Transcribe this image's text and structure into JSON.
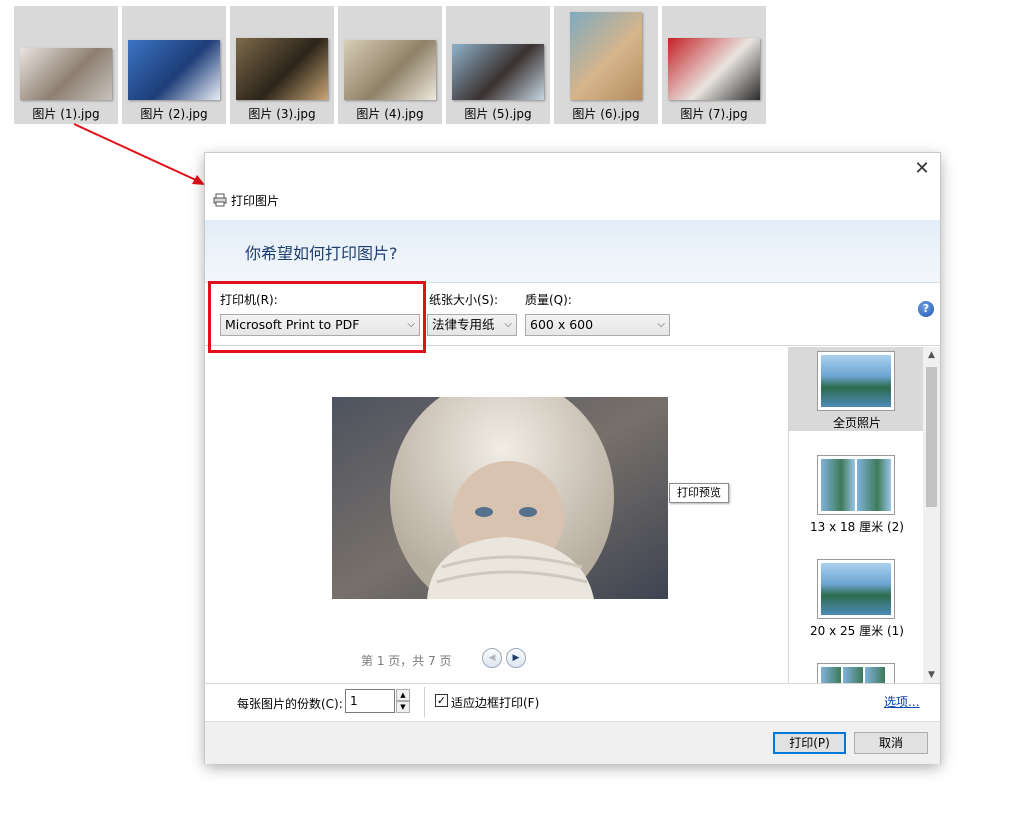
{
  "thumbnails": [
    {
      "label": "图片 (1).jpg",
      "colors": [
        "#e9e4df",
        "#8e7f72",
        "#c8c2bb"
      ]
    },
    {
      "label": "图片 (2).jpg",
      "colors": [
        "#3b74c4",
        "#1e3d78",
        "#e8eef5"
      ]
    },
    {
      "label": "图片 (3).jpg",
      "colors": [
        "#7d6a4b",
        "#2c241a",
        "#c9a676"
      ]
    },
    {
      "label": "图片 (4).jpg",
      "colors": [
        "#d8cdb6",
        "#8f8268",
        "#efe9dd"
      ]
    },
    {
      "label": "图片 (5).jpg",
      "colors": [
        "#8fb3cc",
        "#3b3130",
        "#c6d7e4"
      ]
    },
    {
      "label": "图片 (6).jpg",
      "colors": [
        "#7faac0",
        "#d6b58a",
        "#b48c62"
      ]
    },
    {
      "label": "图片 (7).jpg",
      "colors": [
        "#c52025",
        "#e8e4e0",
        "#2a2a2a"
      ]
    }
  ],
  "dialog": {
    "close_glyph": "✕",
    "title": "打印图片",
    "banner_question": "你希望如何打印图片?",
    "printer_label": "打印机(R):",
    "printer_value": "Microsoft Print to PDF",
    "paper_label": "纸张大小(S):",
    "paper_value": "法律专用纸",
    "quality_label": "质量(Q):",
    "quality_value": "600 x 600",
    "help_glyph": "?",
    "preview_tooltip": "打印预览",
    "page_info": "第 1 页，共 7 页",
    "prev_glyph": "◀",
    "next_glyph": "▶",
    "layouts": [
      {
        "label": "全页照片",
        "selected": true
      },
      {
        "label": "13 x 18 厘米 (2)",
        "selected": false
      },
      {
        "label": "20 x 25 厘米 (1)",
        "selected": false
      },
      {
        "label": "",
        "selected": false
      }
    ],
    "copies_label": "每张图片的份数(C):",
    "copies_value": "1",
    "fit_label": "适应边框打印(F)",
    "fit_checked": true,
    "options_link": "选项...",
    "print_button": "打印(P)",
    "cancel_button": "取消",
    "dropdown_glyph": "⌵",
    "check_glyph": "✓",
    "scroll_up_glyph": "▲",
    "scroll_down_glyph": "▼",
    "spin_up_glyph": "▲",
    "spin_down_glyph": "▼"
  },
  "colors": {
    "annotation_red": "#e2101b",
    "banner_text": "#1e3f6e",
    "link_blue": "#0645ad"
  },
  "icons": [
    "printer-icon",
    "close-icon",
    "help-icon",
    "chevron-down-icon",
    "arrow-annotation"
  ]
}
